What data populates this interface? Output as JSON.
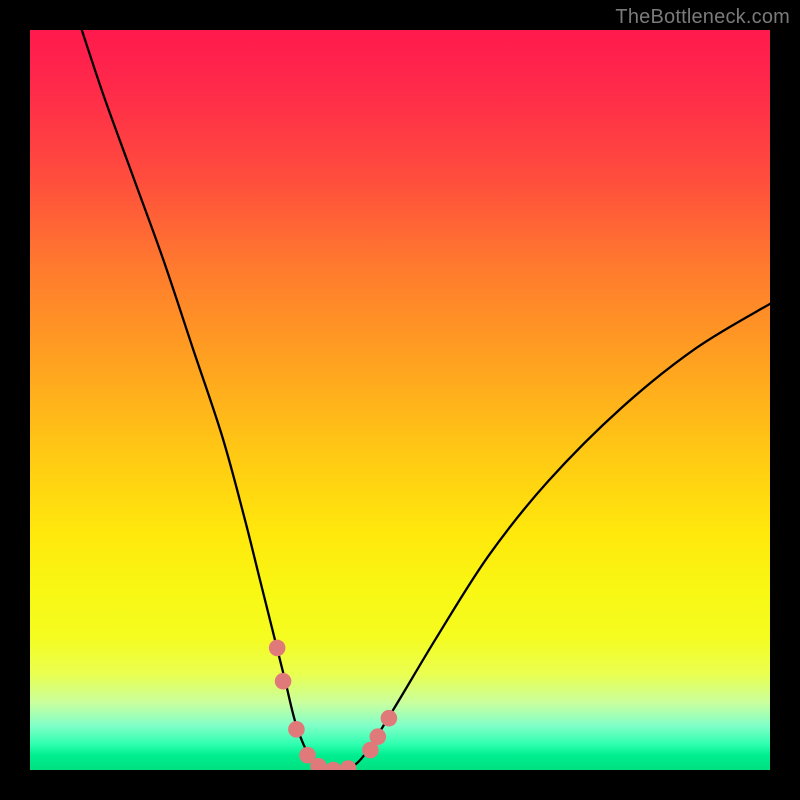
{
  "watermark": "TheBottleneck.com",
  "chart_data": {
    "type": "line",
    "title": "",
    "xlabel": "",
    "ylabel": "",
    "xlim": [
      0,
      100
    ],
    "ylim": [
      0,
      100
    ],
    "series": [
      {
        "name": "bottleneck-curve",
        "x": [
          7,
          10,
          14,
          18,
          22,
          26,
          29,
          31,
          33,
          34.5,
          36,
          38,
          40,
          42.5,
          45,
          49,
          55,
          62,
          70,
          80,
          90,
          100
        ],
        "values": [
          100,
          91,
          80,
          69,
          57,
          45,
          34,
          26,
          18,
          12,
          6,
          1.5,
          0,
          0,
          1.8,
          8,
          18,
          29,
          39,
          49,
          57,
          63
        ]
      }
    ],
    "markers": {
      "name": "highlighted-points",
      "color": "#e07a7a",
      "points": [
        {
          "x": 33.4,
          "y": 16.5
        },
        {
          "x": 34.2,
          "y": 12.0
        },
        {
          "x": 36.0,
          "y": 5.5
        },
        {
          "x": 37.5,
          "y": 2.0
        },
        {
          "x": 39.0,
          "y": 0.5
        },
        {
          "x": 41.0,
          "y": 0.0
        },
        {
          "x": 43.0,
          "y": 0.2
        },
        {
          "x": 46.0,
          "y": 2.7
        },
        {
          "x": 47.0,
          "y": 4.5
        },
        {
          "x": 48.5,
          "y": 7.0
        }
      ]
    },
    "gradient_colors": {
      "top": "#ff1a4d",
      "mid": "#ffe80c",
      "bottom": "#00e080"
    }
  }
}
